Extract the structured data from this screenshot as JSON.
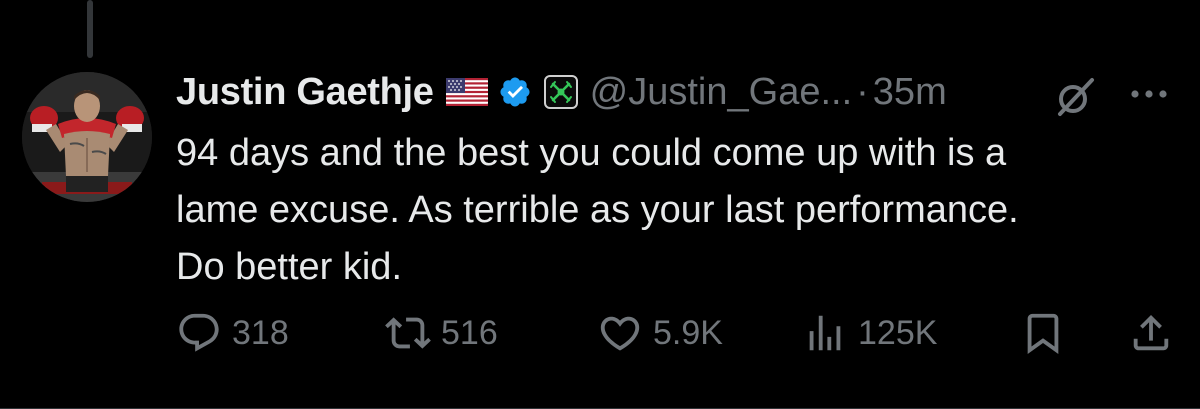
{
  "tweet": {
    "display_name": "Justin Gaethje",
    "flag": "🇺🇸",
    "handle": "@Justin_Gae...",
    "separator": "·",
    "time": "35m",
    "text_lines": [
      "94 days and the best you could come up with is a",
      "lame excuse. As terrible as your last performance.",
      "Do better kid."
    ]
  },
  "actions": {
    "replies": "318",
    "reposts": "516",
    "likes": "5.9K",
    "views": "125K"
  },
  "icons": {
    "verified": "verified-badge-icon",
    "affiliate": "affiliate-badge-icon",
    "grok": "grok-icon",
    "more": "more-icon",
    "reply": "reply-icon",
    "repost": "repost-icon",
    "like": "heart-icon",
    "views": "views-icon",
    "bookmark": "bookmark-icon",
    "share": "share-icon"
  },
  "colors": {
    "background": "#000000",
    "text": "#e7e9ea",
    "muted": "#71767b",
    "verified": "#1d9bf0",
    "affiliate": "#35c759"
  }
}
